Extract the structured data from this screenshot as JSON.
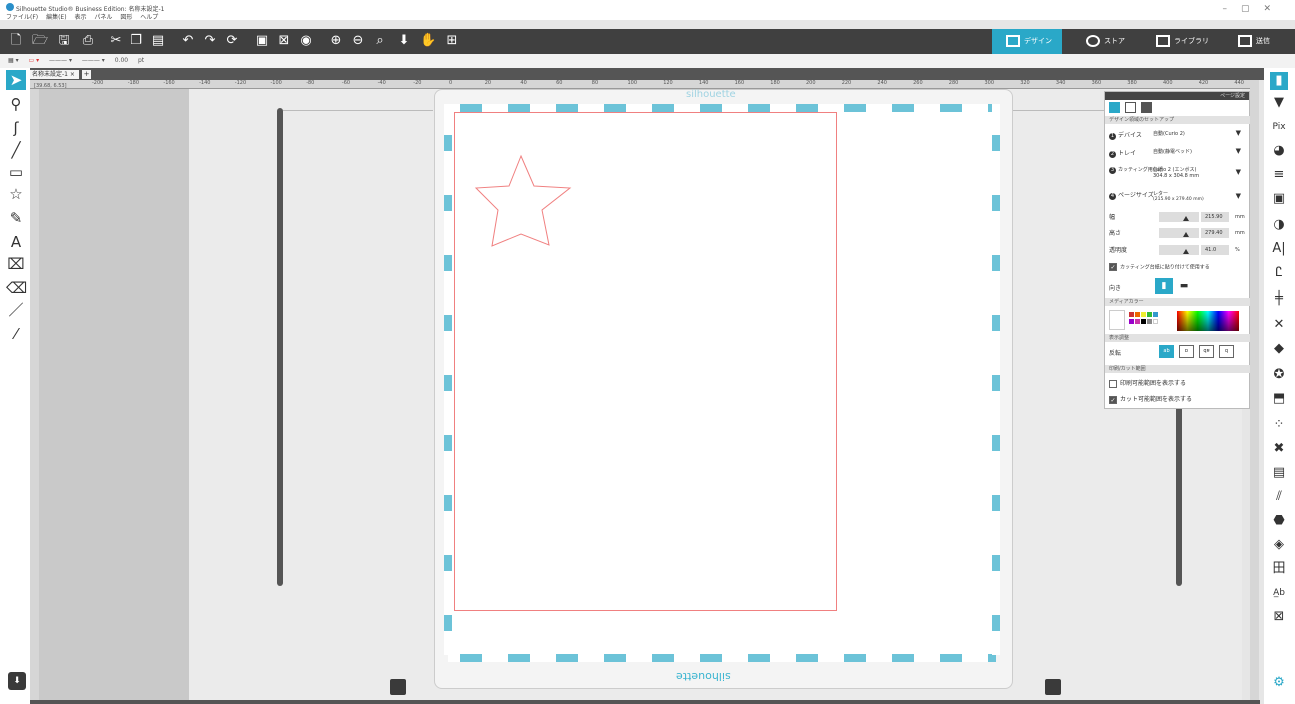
{
  "window": {
    "title": "Silhouette Studio® Business Edition: 名称未設定-1",
    "controls": [
      "–",
      "▢",
      "✕"
    ]
  },
  "menu": [
    "ファイル(F)",
    "編集(E)",
    "表示",
    "パネル",
    "図形",
    "ヘルプ"
  ],
  "nav_tabs": [
    {
      "label": "デザイン",
      "active": true
    },
    {
      "label": "ストア",
      "active": false
    },
    {
      "label": "ライブラリ",
      "active": false
    },
    {
      "label": "送信",
      "active": false
    }
  ],
  "line_options": {
    "stroke_value": "0.00",
    "unit": "pt"
  },
  "doc_tab": {
    "label": "名称未設定-1",
    "close": "×",
    "add": "+"
  },
  "ruler_top": [
    "-200",
    "-180",
    "-160",
    "-140",
    "-120",
    "-100",
    "-80",
    "-60",
    "-40",
    "-20",
    "0",
    "20",
    "40",
    "60",
    "80",
    "100",
    "120",
    "140",
    "160",
    "180",
    "200",
    "220",
    "240",
    "260",
    "280",
    "300",
    "320",
    "340",
    "360",
    "380",
    "400",
    "420",
    "440"
  ],
  "cursor_readout": "[39.68, 6.53]",
  "mat_brand": "silhouette",
  "panel": {
    "header": "ページ設定",
    "section_setup": "デザイン領域のセットアップ",
    "device_label": "デバイス",
    "device_value": "自動(Curio 2)",
    "tray_label": "トレイ",
    "tray_value": "自動(静電ベッド)",
    "mat_label": "カッティング用台紙",
    "mat_value": "Curio 2 (エンボス)",
    "mat_size": "304.8 x 304.8 mm",
    "page_label": "ページサイズ",
    "page_value": "レター",
    "page_size": "(215.90 x 279.40 mm)",
    "width_label": "幅",
    "width_value": "215.90",
    "height_label": "高さ",
    "height_value": "279.40",
    "opacity_label": "透明度",
    "opacity_value": "41.0",
    "unit_mm": "mm",
    "unit_pct": "%",
    "stick_label": "カッティング台紙に貼り付けて使用する",
    "orientation_label": "向き",
    "section_media": "メディアカラー",
    "section_display": "表示調整",
    "flip_label": "反転",
    "section_print": "印刷/カット範囲",
    "print_show_label": "印刷可能範囲を表示する",
    "cut_show_label": "カット可能範囲を表示する",
    "step_numbers": [
      "1",
      "2",
      "3",
      "4"
    ]
  },
  "colors": {
    "accent": "#2aa8c8",
    "toolbar": "#404040",
    "cut_line": "#f08080",
    "hatch": "#6cc3d8"
  },
  "icons": {
    "left_tools": [
      "select-arrow-icon",
      "edit-points-icon",
      "bezier-icon",
      "line-icon",
      "rectangle-icon",
      "star-shape-icon",
      "pencil-icon",
      "text-icon",
      "knife-icon",
      "eraser-icon",
      "pen-icon",
      "eyedropper-icon"
    ],
    "right_tools": [
      "page-setup-icon",
      "panel-icon",
      "pixscan-icon",
      "fill-color-icon",
      "line-style-icon",
      "image-icon",
      "transparency-icon",
      "text-style-icon",
      "trace-icon",
      "align-icon",
      "replicate-icon",
      "modify-icon",
      "offset-icon",
      "rhinestone-icon",
      "sketch-icon",
      "library-icon",
      "layers-icon",
      "hatch-icon",
      "nest-icon",
      "emboss-icon",
      "split-icon",
      "text-to-path-icon",
      "print-icon"
    ]
  }
}
